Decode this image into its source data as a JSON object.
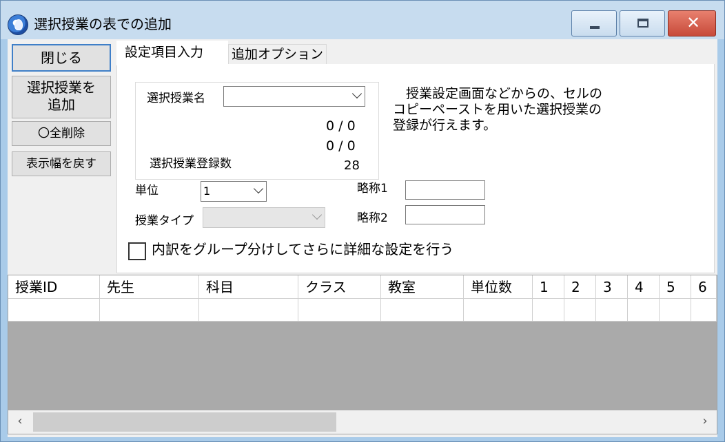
{
  "window": {
    "title": "選択授業の表での追加",
    "controls": {
      "minimize": "",
      "maximize": "",
      "close": "✕"
    }
  },
  "left_buttons": {
    "close": "閉じる",
    "add_line1": "選択授業を",
    "add_line2": "追加",
    "clear_all": "〇全削除",
    "reset_width": "表示幅を戻す"
  },
  "tabs": [
    {
      "label": "設定項目入力",
      "active": true
    },
    {
      "label": "追加オプション",
      "active": false
    }
  ],
  "form": {
    "selected_class_label": "選択授業名",
    "selected_class_value": "",
    "count_a": "0 / 0",
    "count_b": "0 / 0",
    "registered_label": "選択授業登録数",
    "registered_value": "28",
    "unit_label": "単位",
    "unit_value": "1",
    "type_label": "授業タイプ",
    "type_value": "",
    "abbr1_label": "略称1",
    "abbr1_value": "",
    "abbr2_label": "略称2",
    "abbr2_value": "",
    "description": "　授業設定画面などからの、セルの\nコピーペーストを用いた選択授業の\n登録が行えます。",
    "group_checkbox_label": "内訳をグループ分けしてさらに詳細な設定を行う",
    "group_checkbox_checked": false
  },
  "grid": {
    "columns": [
      "授業ID",
      "先生",
      "科目",
      "クラス",
      "教室",
      "単位数",
      "1",
      "2",
      "3",
      "4",
      "5",
      "6"
    ],
    "rows": [
      [
        "",
        "",
        "",
        "",
        "",
        "",
        "",
        "",
        "",
        "",
        "",
        ""
      ]
    ]
  },
  "scrollbar": {
    "left": "‹",
    "right": "›"
  }
}
